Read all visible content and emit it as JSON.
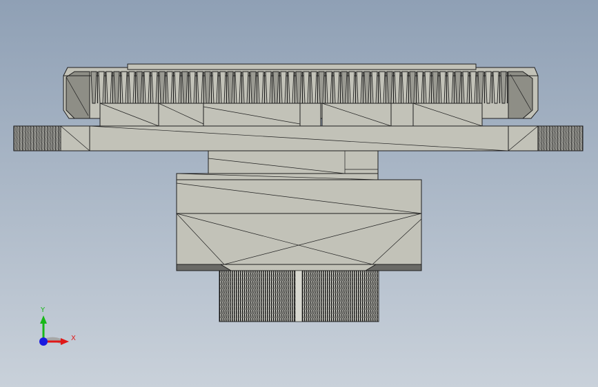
{
  "viewport": {
    "background_top": "#8fa0b5",
    "background_bottom": "#c9d1da",
    "part_color": "#c2c2b8",
    "edge_color": "#1e1e1e"
  },
  "triad": {
    "x_label": "X",
    "y_label": "Y",
    "x_color": "#e01818",
    "y_color": "#18b818",
    "z_color": "#1a1ae0"
  }
}
